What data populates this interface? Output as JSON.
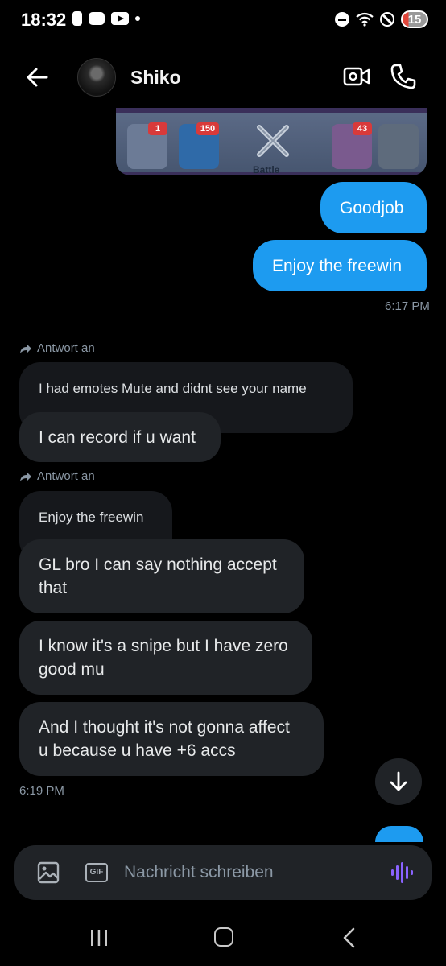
{
  "status_bar": {
    "time": "18:32",
    "battery": "15",
    "icons": [
      "notification-pill-icon",
      "game-controller-icon",
      "youtube-icon",
      "dot-icon",
      "dnd-icon",
      "wifi-icon",
      "blocked-icon"
    ]
  },
  "header": {
    "contact_name": "Shiko",
    "back_icon": "arrow-left-icon",
    "video_icon": "video-call-icon",
    "call_icon": "phone-icon"
  },
  "game_preview": {
    "badge_1": "1",
    "badge_2": "150",
    "badge_3": "43",
    "label": "Battle"
  },
  "messages": {
    "out_1": "Goodjob",
    "out_2": "Enjoy the freewin",
    "out_time": "6:17 PM",
    "reply_label_1": "Antwort an",
    "reply_quote_1": "I had emotes Mute and didnt see your name",
    "in_1": "I can record if u want",
    "reply_label_2": "Antwort an",
    "reply_quote_2": "Enjoy the freewin",
    "in_2_line1": "GL bro I can say nothing accept",
    "in_2_line2": "that",
    "in_3_line1": "I know it's a snipe but I have zero",
    "in_3_line2": "good mu",
    "in_4_line1": "And I thought it's not gonna affect",
    "in_4_line2": "u because u have +6 accs",
    "in_time": "6:19 PM"
  },
  "composer": {
    "placeholder": "Nachricht schreiben",
    "gif_label": "GIF",
    "accent": "#8a63ff"
  },
  "colors": {
    "outgoing_bubble": "#1d9bf0",
    "incoming_bubble": "#202327",
    "background": "#000000"
  }
}
